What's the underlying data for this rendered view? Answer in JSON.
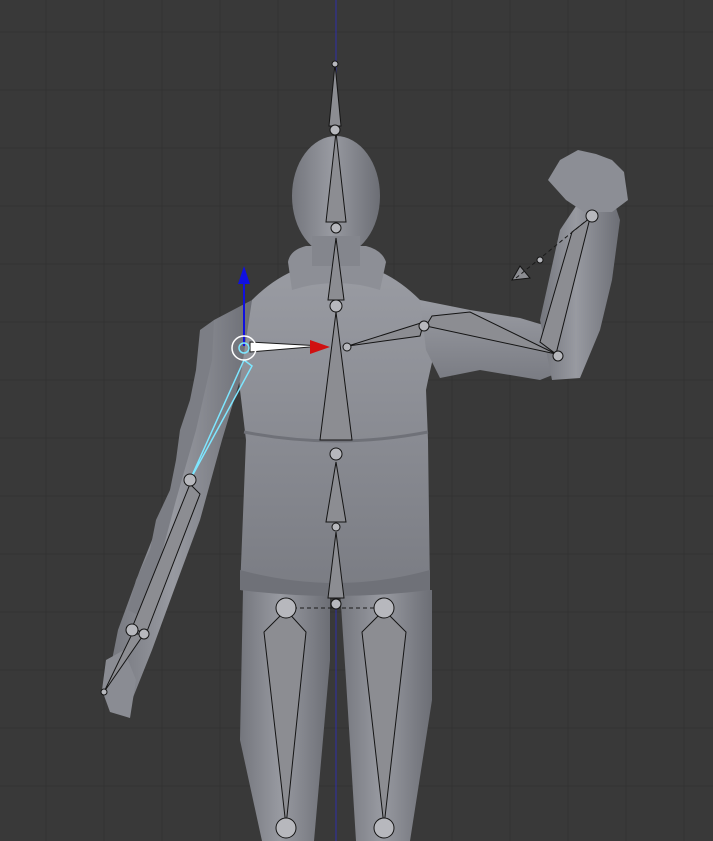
{
  "viewport": {
    "background": "#393939",
    "grid_color": "#333333",
    "grid_axis_color": "#2f2f9a"
  },
  "model": {
    "skin_color": "#8a8c94",
    "shade_color": "#6f7178",
    "highlight_color": "#a9abb2"
  },
  "armature": {
    "bone_fill": "#8c8d92",
    "bone_outline": "#1a1a1a",
    "selected_color": "#7ee6ff",
    "bones": [
      "head",
      "neck",
      "spine-upper",
      "spine-mid",
      "spine-lower",
      "shoulder-r",
      "upper-arm-r",
      "forearm-r",
      "hand-ik-r",
      "upper-arm-l",
      "forearm-l",
      "hand-l",
      "thigh-l",
      "thigh-r",
      "hip-l",
      "hip-r"
    ]
  },
  "manipulator": {
    "x_axis_color": "#d01010",
    "y_axis_color": "#1010e0",
    "center_icon": "pivot-icon"
  }
}
